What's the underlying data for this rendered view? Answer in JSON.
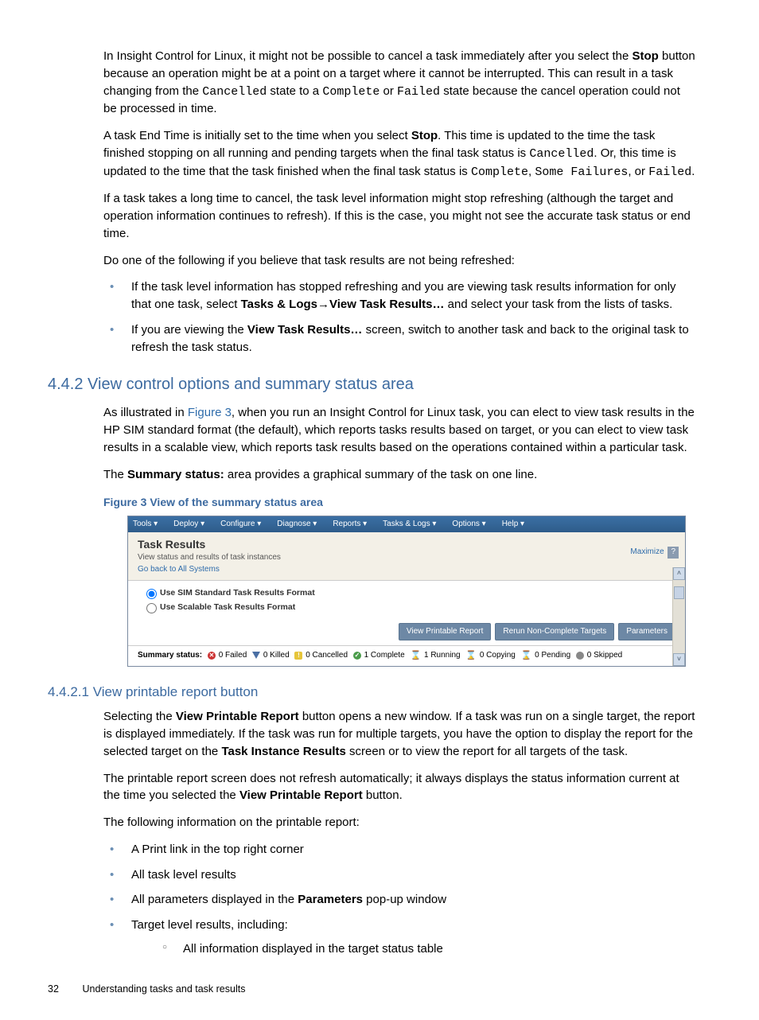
{
  "para1": {
    "a": "In Insight Control for Linux, it might not be possible to cancel a task immediately after you select the ",
    "b": "Stop",
    "c": " button because an operation might be at a point on a target where it cannot be interrupted. This can result in a task changing from the ",
    "d": "Cancelled",
    "e": " state to a ",
    "f": "Complete",
    "g": " or ",
    "h": "Failed",
    "i": " state because the cancel operation could not be processed in time."
  },
  "para2": {
    "a": "A task End Time is initially set to the time when you select ",
    "b": "Stop",
    "c": ". This time is updated to the time the task finished stopping on all running and pending targets when the final task status is ",
    "d": "Cancelled",
    "e": ". Or, this time is updated to the time that the task finished when the final task status is ",
    "f": "Complete",
    "g": ", ",
    "h": "Some Failures",
    "i": ", or ",
    "j": "Failed",
    "k": "."
  },
  "para3": "If a task takes a long time to cancel, the task level information might stop refreshing (although the target and operation information continues to refresh). If this is the case, you might not see the accurate task status or end time.",
  "para4": "Do one of the following if you believe that task results are not being refreshed:",
  "bullets1": {
    "b1": {
      "a": "If the task level information has stopped refreshing and you are viewing task results information for only that one task, select ",
      "b": "Tasks & Logs",
      "arr": "→",
      "c": "View Task Results…",
      "d": " and select your task from the lists of tasks."
    },
    "b2": {
      "a": "If you are viewing the ",
      "b": "View Task Results…",
      "c": " screen, switch to another task and back to the original task to refresh the task status."
    }
  },
  "section": "4.4.2 View control options and summary status area",
  "para5": {
    "a": "As illustrated in ",
    "b": "Figure 3",
    "c": ", when you run an Insight Control for Linux task, you can elect to view task results in the HP SIM standard format (the default), which reports tasks results based on target, or you can elect to view task results in a scalable view, which reports task results based on the operations contained within a particular task."
  },
  "para6": {
    "a": "The ",
    "b": "Summary status:",
    "c": " area provides a graphical summary of the task on one line."
  },
  "figcap": "Figure 3 View of the summary status area",
  "screenshot": {
    "menu": [
      "Tools ▾",
      "Deploy ▾",
      "Configure ▾",
      "Diagnose ▾",
      "Reports ▾",
      "Tasks & Logs ▾",
      "Options ▾",
      "Help ▾"
    ],
    "title": "Task Results",
    "subtitle": "View status and results of task instances",
    "goback": "Go back to All Systems",
    "maximize": "Maximize",
    "radio1": "Use SIM Standard Task Results Format",
    "radio2": "Use Scalable Task Results Format",
    "btn1": "View Printable Report",
    "btn2": "Rerun Non-Complete Targets",
    "btn3": "Parameters",
    "summary": {
      "label": "Summary status:",
      "failed": " 0 Failed ",
      "killed": " 0 Killed ",
      "cancelled": " 0 Cancelled ",
      "complete": " 1 Complete ",
      "running": " 1 Running ",
      "copying": " 0 Copying ",
      "pending": " 0 Pending ",
      "skipped": " 0 Skipped"
    }
  },
  "subsection": "4.4.2.1 View printable report button",
  "para7": {
    "a": "Selecting the ",
    "b": "View Printable Report",
    "c": " button opens a new window. If a task was run on a single target, the report is displayed immediately. If the task was run for multiple targets, you have the option to display the report for the selected target on the ",
    "d": "Task Instance Results",
    "e": " screen or to view the report for all targets of the task."
  },
  "para8": {
    "a": "The printable report screen does not refresh automatically; it always displays the status information current at the time you selected the ",
    "b": "View Printable Report",
    "c": " button."
  },
  "para9": "The following information on the printable report:",
  "bullets2": {
    "b1": "A Print link in the top right corner",
    "b2": "All task level results",
    "b3": {
      "a": "All parameters displayed in the ",
      "b": "Parameters",
      "c": " pop-up window"
    },
    "b4": "Target level results, including:",
    "sub1": "All information displayed in the target status table"
  },
  "footer": {
    "num": "32",
    "text": "Understanding tasks and task results"
  }
}
